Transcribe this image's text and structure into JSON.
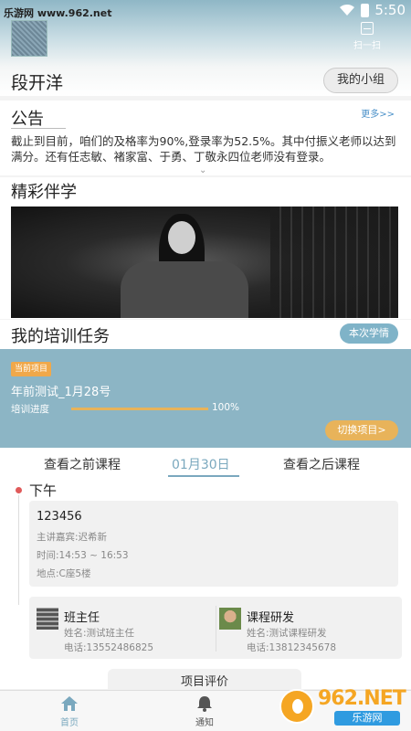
{
  "status_bar": {
    "watermark": "乐游网 www.962.net",
    "time": "5:50"
  },
  "header": {
    "scan_label": "扫一扫",
    "username": "段开洋",
    "group_button": "我的小组"
  },
  "announcement": {
    "title": "公告",
    "more": "更多>>",
    "text": "截止到目前，咱们的及格率为90%,登录率为52.5%。其中付振义老师以达到满分。还有任志敏、褚家富、于勇、丁敬永四位老师没有登录。"
  },
  "featured": {
    "title": "精彩伴学"
  },
  "training": {
    "title": "我的培训任务",
    "this_term_button": "本次学情",
    "current_tag": "当前项目",
    "project_name": "年前测试_1月28号",
    "progress_label": "培训进度",
    "progress_value": "100%",
    "progress_fraction": 1.0,
    "switch_button": "切换项目>"
  },
  "date_tabs": {
    "prev": "查看之前课程",
    "current": "01月30日",
    "next": "查看之后课程"
  },
  "schedule": {
    "period": "下午",
    "course": {
      "title": "123456",
      "speaker": "主讲嘉宾:迟希新",
      "time": "时间:14:53 ~ 16:53",
      "location": "地点:C座5楼"
    }
  },
  "contacts": [
    {
      "role": "班主任",
      "name": "姓名:测试班主任",
      "phone": "电话:13552486825"
    },
    {
      "role": "课程研发",
      "name": "姓名:测试课程研发",
      "phone": "电话:13812345678"
    }
  ],
  "evaluate_button": "项目评价",
  "bottom_nav": {
    "home": "首页",
    "notice": "通知"
  },
  "logo": {
    "text": "962.NET",
    "sub": "乐游网"
  },
  "colors": {
    "accent": "#7aa8be",
    "card": "#8cb5c5",
    "orange": "#e8b35a",
    "dot": "#e05a5a"
  }
}
